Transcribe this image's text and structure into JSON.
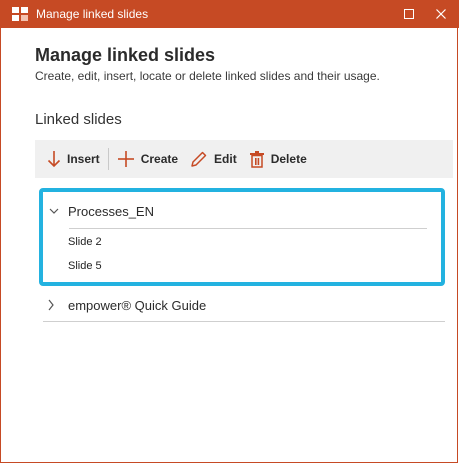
{
  "window": {
    "title": "Manage linked slides",
    "accent_color": "#c64a24",
    "controls": {
      "maximize_icon": "maximize-icon",
      "close_icon": "close-icon"
    }
  },
  "header": {
    "title": "Manage linked slides",
    "subtitle": "Create, edit, insert, locate or delete linked slides and their usage."
  },
  "section": {
    "title": "Linked slides"
  },
  "toolbar": {
    "insert_label": "Insert",
    "create_label": "Create",
    "edit_label": "Edit",
    "delete_label": "Delete"
  },
  "groups": [
    {
      "name": "Processes_EN",
      "expanded": true,
      "selected": true,
      "selection_color": "#23b2e0",
      "slides": [
        "Slide 2",
        "Slide 5"
      ]
    },
    {
      "name": "empower® Quick Guide",
      "expanded": false,
      "selected": false,
      "slides": []
    }
  ]
}
